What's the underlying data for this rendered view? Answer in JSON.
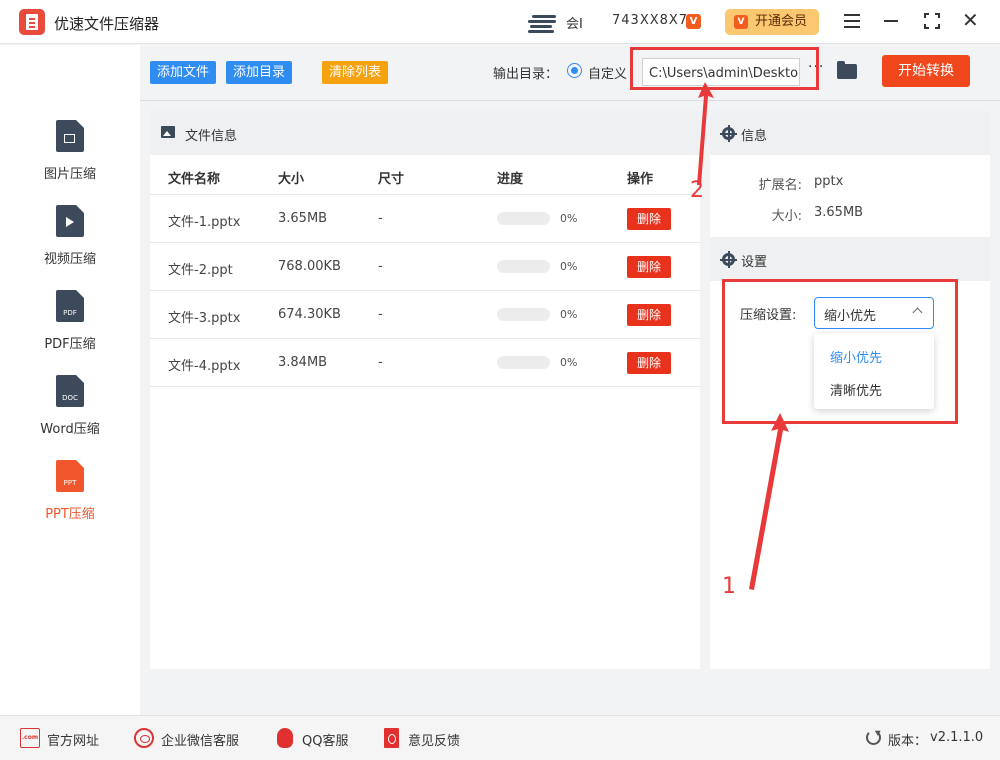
{
  "app": {
    "title": "优速文件压缩器"
  },
  "titlebar": {
    "member_label": "会I",
    "user_id": "743XX8X70",
    "vip_badge": "V",
    "vip_button_label": "开通会员"
  },
  "sidebar": {
    "items": [
      {
        "label": "图片压缩",
        "icon": "image-file-icon",
        "icon_text": ""
      },
      {
        "label": "视频压缩",
        "icon": "video-file-icon",
        "icon_text": ""
      },
      {
        "label": "PDF压缩",
        "icon": "pdf-file-icon",
        "icon_text": "PDF"
      },
      {
        "label": "Word压缩",
        "icon": "doc-file-icon",
        "icon_text": "DOC"
      },
      {
        "label": "PPT压缩",
        "icon": "ppt-file-icon",
        "icon_text": "PPT",
        "active": true
      }
    ]
  },
  "toolbar": {
    "add_file": "添加文件",
    "add_dir": "添加目录",
    "clear_list": "清除列表",
    "output_label": "输出目录：",
    "custom_label": "自定义",
    "output_path": "C:\\Users\\admin\\Desktop",
    "more": "···",
    "start": "开始转换"
  },
  "file_panel": {
    "title": "文件信息",
    "columns": [
      "文件名称",
      "大小",
      "尺寸",
      "进度",
      "操作"
    ],
    "rows": [
      {
        "name": "文件-1.pptx",
        "size": "3.65MB",
        "dim": "-",
        "progress": 0,
        "progress_text": "0%",
        "action": "删除"
      },
      {
        "name": "文件-2.ppt",
        "size": "768.00KB",
        "dim": "-",
        "progress": 0,
        "progress_text": "0%",
        "action": "删除"
      },
      {
        "name": "文件-3.pptx",
        "size": "674.30KB",
        "dim": "-",
        "progress": 0,
        "progress_text": "0%",
        "action": "删除"
      },
      {
        "name": "文件-4.pptx",
        "size": "3.84MB",
        "dim": "-",
        "progress": 0,
        "progress_text": "0%",
        "action": "删除"
      }
    ]
  },
  "info_panel": {
    "title": "信息",
    "ext_label": "扩展名:",
    "ext_value": "pptx",
    "size_label": "大小:",
    "size_value": "3.65MB"
  },
  "settings_panel": {
    "title": "设置",
    "compress_label": "压缩设置:",
    "compress_value": "缩小优先",
    "options": [
      "缩小优先",
      "清晰优先"
    ]
  },
  "annotations": {
    "one": "1",
    "two": "2"
  },
  "footer": {
    "website": "官方网址",
    "wechat": "企业微信客服",
    "qq": "QQ客服",
    "feedback": "意见反馈",
    "version_label": "版本：",
    "version_value": "v2.1.1.0",
    "com_text": ".com"
  },
  "colors": {
    "accent_blue": "#2f8cf0",
    "accent_red": "#f0471d",
    "annotation": "#e83a3a",
    "clear_orange": "#f6a10e"
  }
}
